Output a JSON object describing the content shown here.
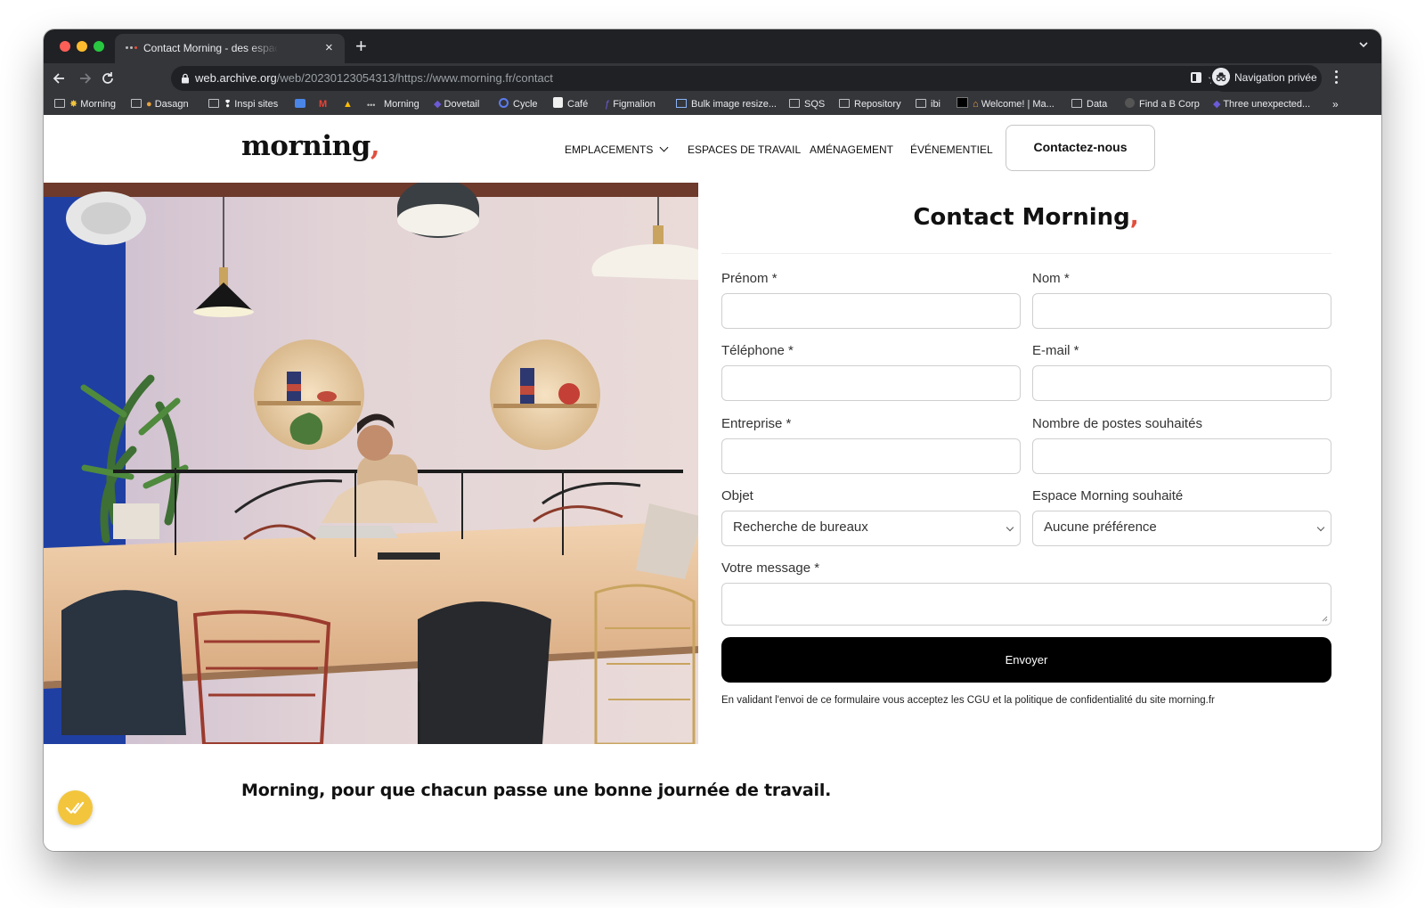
{
  "browser": {
    "tab_title": "Contact Morning - des espaces de travail",
    "tab_close": "×",
    "new_tab": "+",
    "url_host": "web.archive.org",
    "url_rest": "/web/20230123054313/https://www.morning.fr/contact",
    "profile_label": "Navigation privée",
    "bookmarks": [
      "Morning",
      "Dasagn",
      "Inspi sites",
      "Morning",
      "Dovetail",
      "Cycle",
      "Café",
      "Figmalion",
      "Bulk image resize...",
      "SQS",
      "Repository",
      "ibi",
      "Welcome! | Ma...",
      "Data",
      "Find a B Corp",
      "Three unexpected..."
    ],
    "bookmarks_more": "»"
  },
  "site": {
    "logo_text": "morning",
    "logo_comma": ",",
    "nav": [
      "EMPLACEMENTS",
      "ESPACES DE TRAVAIL",
      "AMÉNAGEMENT",
      "ÉVÉNEMENTIEL"
    ],
    "contact_button": "Contactez-nous"
  },
  "form": {
    "title": "Contact Morning",
    "title_comma": ",",
    "firstname_label": "Prénom *",
    "lastname_label": "Nom *",
    "phone_label": "Téléphone *",
    "email_label": "E-mail *",
    "company_label": "Entreprise *",
    "seats_label": "Nombre de postes souhaités",
    "subject_label": "Objet",
    "subject_value": "Recherche de bureaux",
    "space_label": "Espace Morning souhaité",
    "space_value": "Aucune préférence",
    "message_label": "Votre message *",
    "submit": "Envoyer",
    "legal": "En validant l'envoi de ce formulaire vous acceptez les CGU et la politique de confidentialité du site morning.fr"
  },
  "tagline": "Morning, pour que chacun passe une bonne journée de travail.",
  "colors": {
    "accent": "#e24f3d",
    "badge": "#f2c53d",
    "chrome_dark": "#202124",
    "chrome_mid": "#35363a"
  }
}
